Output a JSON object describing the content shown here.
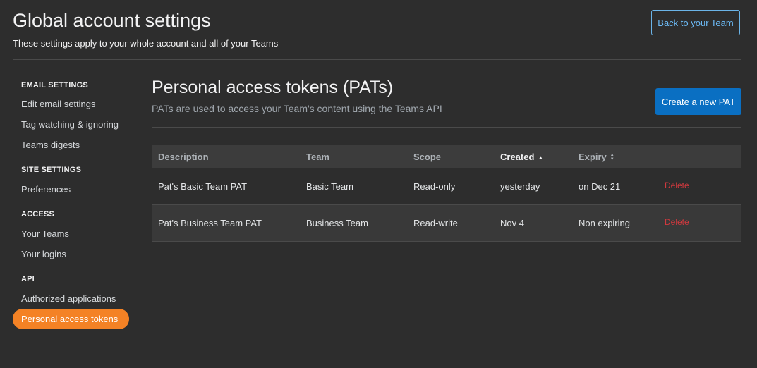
{
  "header": {
    "title": "Global account settings",
    "subtitle": "These settings apply to your whole account and all of your Teams",
    "back_button": "Back to your Team"
  },
  "sidebar": {
    "sections": [
      {
        "heading": "EMAIL SETTINGS",
        "items": [
          "Edit email settings",
          "Tag watching & ignoring",
          "Teams digests"
        ]
      },
      {
        "heading": "SITE SETTINGS",
        "items": [
          "Preferences"
        ]
      },
      {
        "heading": "ACCESS",
        "items": [
          "Your Teams",
          "Your logins"
        ]
      },
      {
        "heading": "API",
        "items": [
          "Authorized applications",
          "Personal access tokens"
        ]
      }
    ],
    "active_item": "Personal access tokens",
    "active_color": "#f48225"
  },
  "main": {
    "title": "Personal access tokens (PATs)",
    "subtitle": "PATs are used to access your Team's content using the Teams API",
    "create_button": "Create a new PAT"
  },
  "table": {
    "columns": [
      "Description",
      "Team",
      "Scope",
      "Created",
      "Expiry"
    ],
    "sorted_column": "Created",
    "rows": [
      {
        "description": "Pat's Basic Team PAT",
        "team": "Basic Team",
        "scope": "Read-only",
        "created": "yesterday",
        "expiry": "on Dec 21",
        "action": "Delete"
      },
      {
        "description": "Pat's Business Team PAT",
        "team": "Business Team",
        "scope": "Read-write",
        "created": "Nov 4",
        "expiry": "Non expiring",
        "action": "Delete"
      }
    ]
  },
  "colors": {
    "background": "#2d2d2d",
    "link": "#6cbbf7",
    "primary_button": "#0a6fc2",
    "danger": "#d0393e"
  }
}
